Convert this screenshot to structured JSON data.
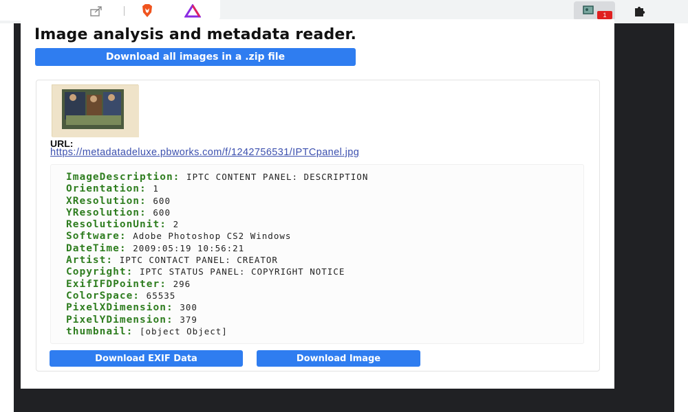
{
  "popup": {
    "title": "Image analysis and metadata reader.",
    "download_zip_label": "Download all images in a .zip file"
  },
  "image": {
    "url_label": "URL:",
    "url": "https://metadatadeluxe.pbworks.com/f/1242756531/IPTCpanel.jpg"
  },
  "metadata": [
    {
      "key": "ImageDescription:",
      "value": "IPTC CONTENT PANEL: DESCRIPTION"
    },
    {
      "key": "Orientation:",
      "value": "1"
    },
    {
      "key": "XResolution:",
      "value": "600"
    },
    {
      "key": "YResolution:",
      "value": "600"
    },
    {
      "key": "ResolutionUnit:",
      "value": "2"
    },
    {
      "key": "Software:",
      "value": "Adobe Photoshop CS2 Windows"
    },
    {
      "key": "DateTime:",
      "value": "2009:05:19 10:56:21"
    },
    {
      "key": "Artist:",
      "value": "IPTC CONTACT PANEL: CREATOR"
    },
    {
      "key": "Copyright:",
      "value": "IPTC STATUS PANEL: COPYRIGHT NOTICE"
    },
    {
      "key": "ExifIFDPointer:",
      "value": "296"
    },
    {
      "key": "ColorSpace:",
      "value": "65535"
    },
    {
      "key": "PixelXDimension:",
      "value": "300"
    },
    {
      "key": "PixelYDimension:",
      "value": "379"
    },
    {
      "key": "thumbnail:",
      "value": "[object Object]"
    }
  ],
  "actions": {
    "download_exif_label": "Download EXIF Data",
    "download_image_label": "Download Image"
  },
  "toolbar": {
    "badge_text": "1",
    "icons": [
      "share-icon",
      "brave-shields-icon",
      "brave-rewards-icon",
      "metadata-extension-icon",
      "extensions-puzzle-icon"
    ]
  },
  "colors": {
    "accent_button": "#2f7df0",
    "metadata_key": "#2e7d1f",
    "link": "#3b4fae",
    "badge": "#e02020"
  }
}
